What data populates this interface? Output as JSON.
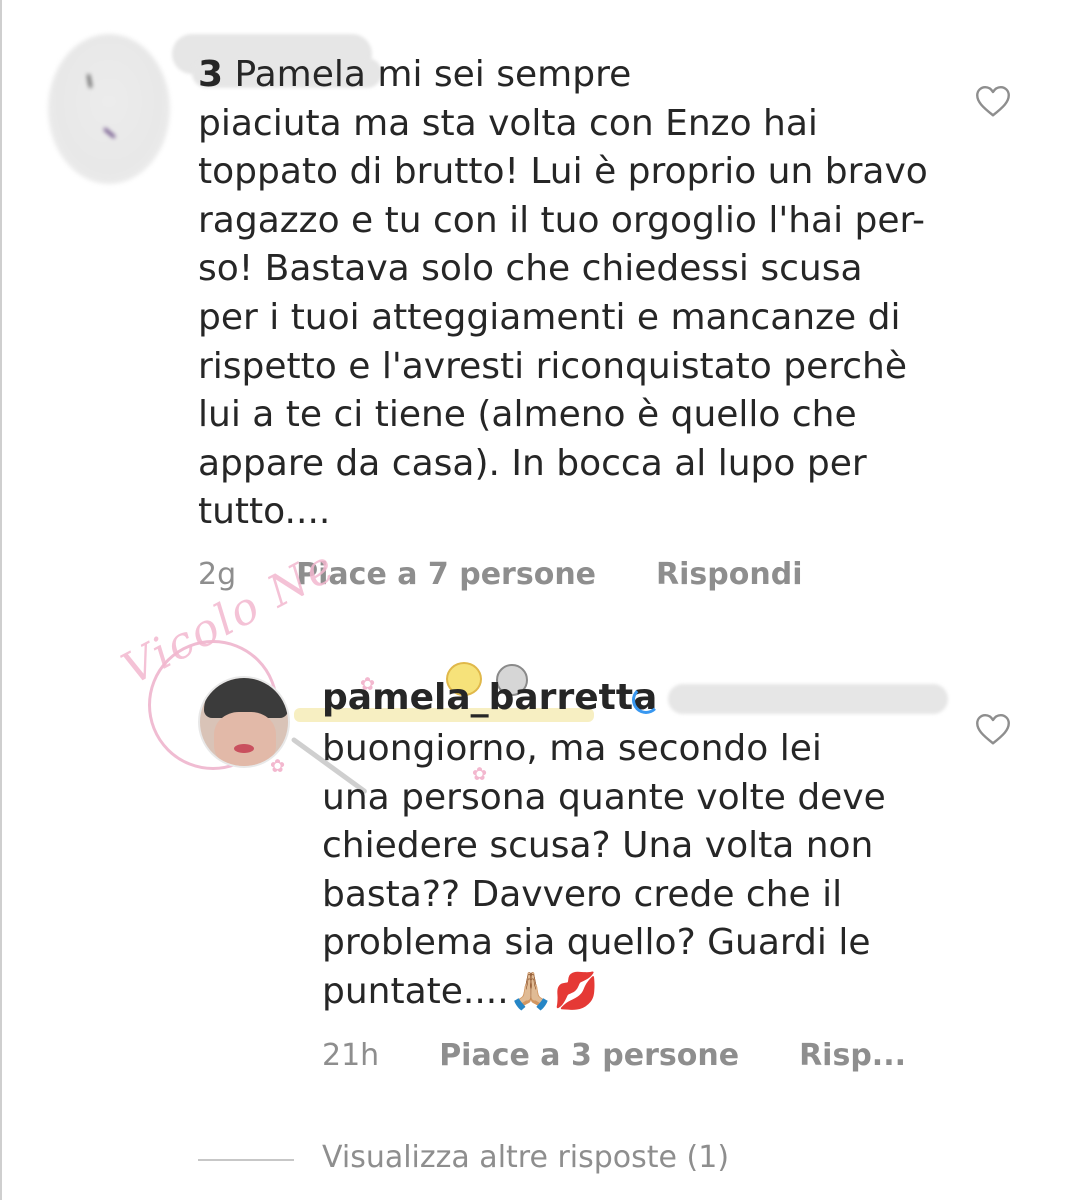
{
  "comment": {
    "username": "",
    "username_visible_fragment": "3",
    "text_line1": "Pamela mi sei sempre",
    "text_rest": "piaciuta ma sta volta con Enzo hai\ntoppato di brutto! Lui è proprio un bravo\nragazzo e tu con il tuo orgoglio l'hai per-\nso! Bastava solo che chiedessi scusa\nper i tuoi atteggiamenti e mancanze di\nrispetto e l'avresti riconquistato perchè\nlui a te ci tiene (almeno è quello che\nappare da casa). In bocca al lupo per\ntutto....",
    "time": "2g",
    "likes": "Piace a 7 persone",
    "reply_label": "Rispondi",
    "like_icon": "heart-outline-icon"
  },
  "reply": {
    "username": "pamela_barretta",
    "text": "buongiorno, ma secondo lei\nuna persona quante volte deve\nchiedere scusa? Una volta non\nbasta?? Davvero crede che il\nproblema sia quello? Guardi le\npuntate....🙏🏼💋",
    "time": "21h",
    "likes": "Piace a 3 persone",
    "reply_label": "Risp...",
    "like_icon": "heart-outline-icon",
    "watermark": "Vicolo Ne",
    "verified_icon": "verified-badge-icon"
  },
  "view_more": {
    "label": "Visualizza altre risposte (1)"
  },
  "colors": {
    "text": "#262626",
    "meta": "#8e8e8e",
    "watermark_pink": "#f3b8cf",
    "verified_blue": "#3897f0"
  }
}
